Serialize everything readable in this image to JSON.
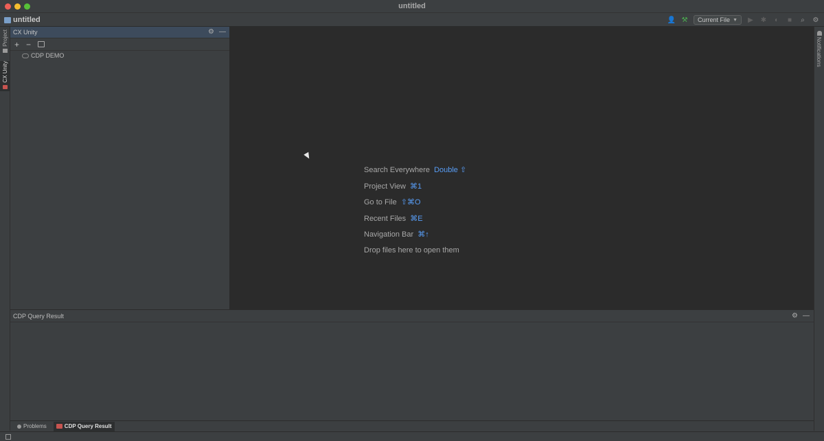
{
  "window": {
    "title": "untitled"
  },
  "toolbar": {
    "project_name": "untitled",
    "run_config": "Current File",
    "icons": [
      "user-icon",
      "build-hammer-icon",
      "run-icon",
      "debug-icon",
      "coverage-icon",
      "stop-icon",
      "search-icon",
      "settings-gear-icon"
    ]
  },
  "left_stripe": {
    "tabs": [
      {
        "label": "Project"
      },
      {
        "label": "CX Unity"
      }
    ]
  },
  "right_stripe": {
    "label": "Notifications"
  },
  "tool_window": {
    "title": "CX Unity",
    "tree": [
      {
        "label": "CDP DEMO"
      }
    ]
  },
  "editor": {
    "hints": [
      {
        "label": "Search Everywhere",
        "shortcut": "Double ⇧"
      },
      {
        "label": "Project View",
        "shortcut": "⌘1"
      },
      {
        "label": "Go to File",
        "shortcut": "⇧⌘O"
      },
      {
        "label": "Recent Files",
        "shortcut": "⌘E"
      },
      {
        "label": "Navigation Bar",
        "shortcut": "⌘↑"
      },
      {
        "label": "Drop files here to open them",
        "shortcut": ""
      }
    ]
  },
  "bottom_panel": {
    "title": "CDP Query Result"
  },
  "bottom_tabs": [
    {
      "label": "Problems"
    },
    {
      "label": "CDP Query Result"
    }
  ],
  "colors": {
    "accent": "#589df6",
    "header_active": "#3d4b5c",
    "editor_bg": "#2b2b2b"
  }
}
